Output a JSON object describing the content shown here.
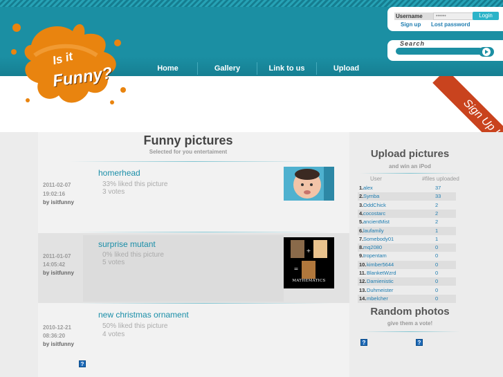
{
  "logo": {
    "line1": "Is it",
    "line2": "Funny?"
  },
  "nav": [
    {
      "label": "Home"
    },
    {
      "label": "Gallery"
    },
    {
      "label": "Link to us"
    },
    {
      "label": "Upload"
    }
  ],
  "login": {
    "username_label": "Username",
    "password_value": "••••••",
    "login_button": "Login",
    "signup_link": "Sign up",
    "lost_password_link": "Lost password"
  },
  "search": {
    "label": "Search",
    "placeholder": ""
  },
  "ribbon": {
    "label": "Sign Up !"
  },
  "main": {
    "title": "Funny pictures",
    "subtitle": "Selected for you entertaiment",
    "posts": [
      {
        "date": "2011-02-07",
        "time": "19:02:16",
        "by": "by isitfunny",
        "title": "homerhead",
        "liked": "33% liked this picture",
        "votes": "3 votes"
      },
      {
        "date": "2011-01-07",
        "time": "14:05:42",
        "by": "by isitfunny",
        "title": "surprise mutant",
        "liked": "0% liked this picture",
        "votes": "5 votes",
        "image_caption": "MATHEMATICS"
      },
      {
        "date": "2010-12-21",
        "time": "08:36:20",
        "by": "by isitfunny",
        "title": "new christmas ornament",
        "liked": "50% liked this picture",
        "votes": "4 votes"
      }
    ]
  },
  "sidebar": {
    "upload_title": "Upload pictures",
    "upload_sub": "and win an iPod",
    "col_user": "User",
    "col_files": "#files uploaded",
    "rows": [
      {
        "rank": "1.",
        "user": "alex",
        "count": "37"
      },
      {
        "rank": "2.",
        "user": "Symba",
        "count": "33"
      },
      {
        "rank": "3.",
        "user": "OddChick",
        "count": "2"
      },
      {
        "rank": "4.",
        "user": "cocostarc",
        "count": "2"
      },
      {
        "rank": "5.",
        "user": "ancientMist",
        "count": "2"
      },
      {
        "rank": "6.",
        "user": "laufamily",
        "count": "1"
      },
      {
        "rank": "7.",
        "user": "Somebody01",
        "count": "1"
      },
      {
        "rank": "8.",
        "user": "mq2080",
        "count": "0"
      },
      {
        "rank": "9.",
        "user": "tropentam",
        "count": "0"
      },
      {
        "rank": "10.",
        "user": "kimber5644",
        "count": "0"
      },
      {
        "rank": "11.",
        "user": "BlanketWzrd",
        "count": "0"
      },
      {
        "rank": "12.",
        "user": "Damienistic",
        "count": "0"
      },
      {
        "rank": "13.",
        "user": "Duhmeister",
        "count": "0"
      },
      {
        "rank": "14.",
        "user": "mbelcher",
        "count": "0"
      }
    ],
    "random_title": "Random photos",
    "random_sub": "give them a vote!"
  },
  "icons": {
    "help": "?"
  }
}
